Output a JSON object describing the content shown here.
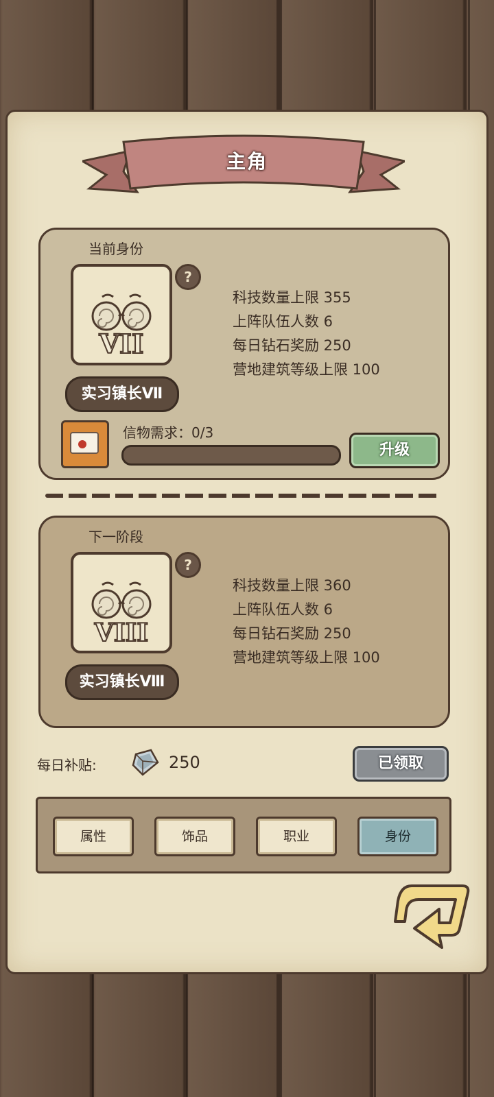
{
  "header": {
    "title": "主角"
  },
  "current": {
    "label": "当前身份",
    "rank_numeral": "VII",
    "rank_name": "实习镇长Ⅶ",
    "help_symbol": "?",
    "stats": [
      "科技数量上限 355",
      "上阵队伍人数 6",
      "每日钻石奖励 250",
      "营地建筑等级上限 100"
    ],
    "requirement_label": "信物需求：0/3",
    "requirement_progress": 0,
    "upgrade_label": "升级"
  },
  "next": {
    "label": "下一阶段",
    "rank_numeral": "VIII",
    "rank_name": "实习镇长Ⅷ",
    "help_symbol": "?",
    "stats": [
      "科技数量上限 360",
      "上阵队伍人数 6",
      "每日钻石奖励 250",
      "营地建筑等级上限 100"
    ]
  },
  "daily": {
    "label": "每日补贴:",
    "value": "250",
    "claimed_label": "已领取"
  },
  "tabs": [
    {
      "label": "属性",
      "active": false
    },
    {
      "label": "饰品",
      "active": false
    },
    {
      "label": "职业",
      "active": false
    },
    {
      "label": "身份",
      "active": true
    }
  ],
  "icons": {
    "help": "question-mark-icon",
    "token": "letter-token-icon",
    "diamond": "diamond-icon",
    "back": "back-arrow-icon",
    "portrait": "glasses-portrait-icon"
  },
  "colors": {
    "upgrade_button": "#8db88a",
    "claimed_button": "#8a8e92",
    "active_tab": "#8fb2b6",
    "banner": "#b97d76"
  }
}
